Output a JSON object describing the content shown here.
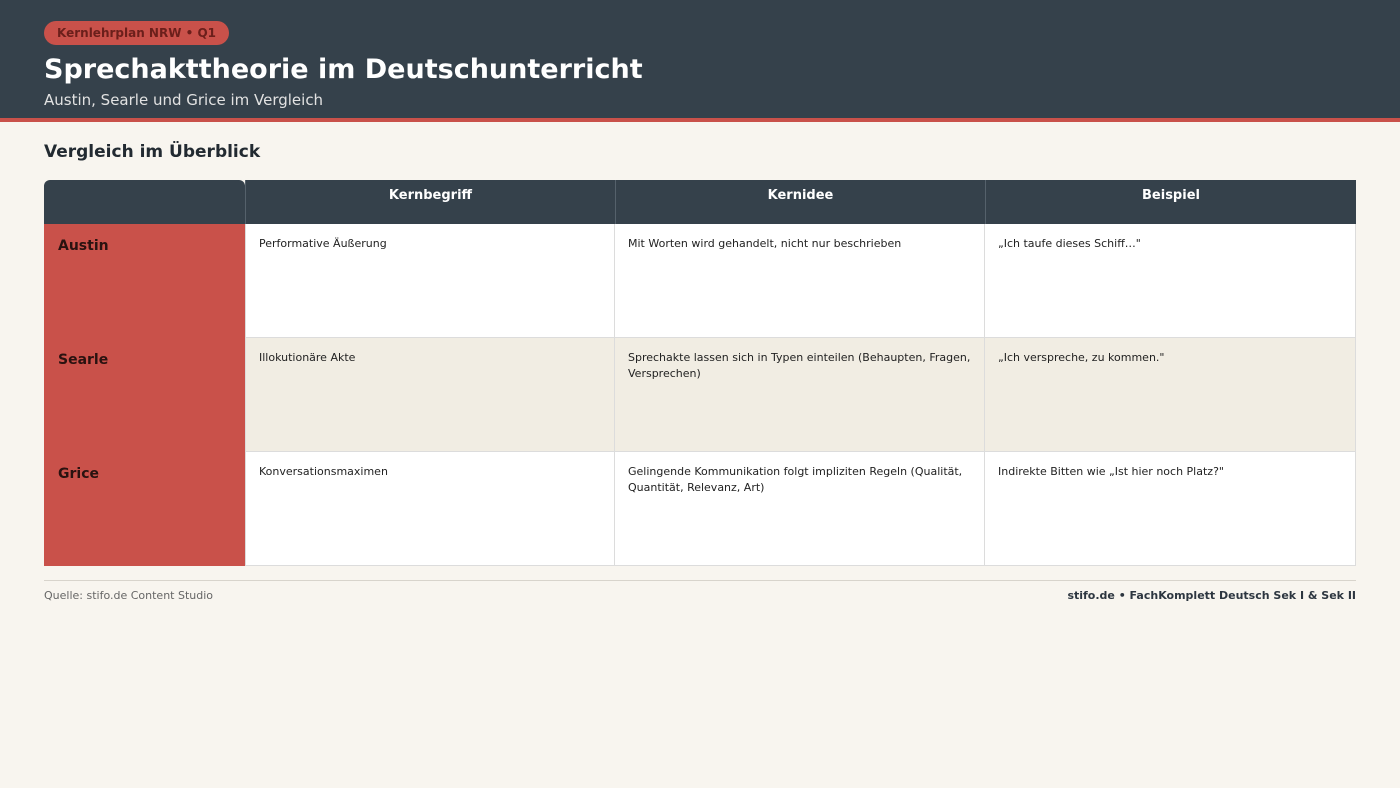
{
  "header": {
    "badge": "Kernlehrplan NRW • Q1",
    "title": "Sprechakttheorie im Deutschunterricht",
    "subtitle": "Austin, Searle und Grice im Vergleich"
  },
  "section": {
    "title": "Vergleich im Überblick"
  },
  "table": {
    "columns": [
      "Kernbegriff",
      "Kernidee",
      "Beispiel"
    ],
    "rows": [
      {
        "name": "Austin",
        "cells": [
          "Performative Äußerung",
          "Mit Worten wird gehandelt, nicht nur beschrieben",
          "„Ich taufe dieses Schiff…\""
        ]
      },
      {
        "name": "Searle",
        "cells": [
          "Illokutionäre Akte",
          "Sprechakte lassen sich in Typen einteilen (Behaupten, Fragen, Versprechen)",
          "„Ich verspreche, zu kommen.\""
        ]
      },
      {
        "name": "Grice",
        "cells": [
          "Konversationsmaximen",
          "Gelingende Kommunikation folgt impliziten Regeln (Qualität, Quantität, Relevanz, Art)",
          "Indirekte Bitten wie „Ist hier noch Platz?\""
        ]
      }
    ]
  },
  "footer": {
    "source": "Quelle: stifo.de Content Studio",
    "brand": "stifo.de • FachKomplett Deutsch Sek I & Sek II"
  },
  "colors": {
    "header_bg": "#35414b",
    "accent": "#c9514a",
    "page_bg": "#f8f5ef",
    "alt_row": "#f1ede3"
  }
}
